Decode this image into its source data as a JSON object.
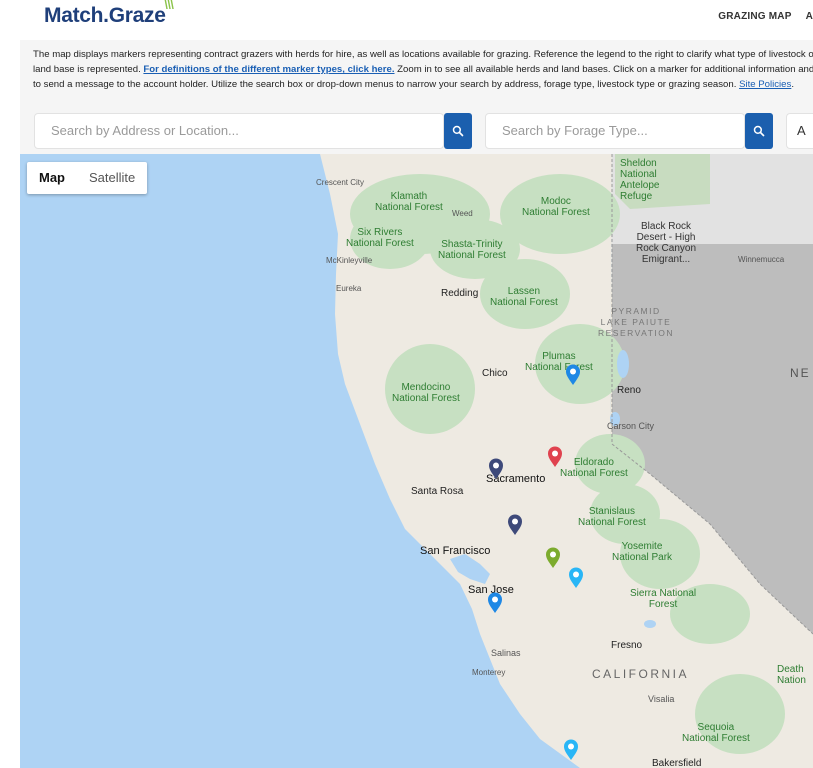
{
  "header": {
    "logo_text": "Match.Graze",
    "logo_accent": "\\\\\\",
    "nav": [
      "GRAZING MAP",
      "A"
    ]
  },
  "intro": {
    "text_before_link": "The map displays markers representing contract grazers with herds for hire, as well as locations available for grazing. Reference the legend to the right to clarify what type of livestock or land base is represented. ",
    "link_text": "For definitions of the different marker types, click here.",
    "text_after_link": " Zoom in to see all available herds and land bases. Click on a marker for additional information and to send a message to the account holder. Utilize the search box or drop-down menus to narrow your search by address, forage type, livestock type or grazing season. ",
    "policies_link": "Site Policies",
    "policies_suffix": "."
  },
  "search": {
    "address_placeholder": "Search by Address or Location...",
    "forage_placeholder": "Search by Forage Type...",
    "third_value": "A"
  },
  "map": {
    "map_type_options": [
      "Map",
      "Satellite"
    ],
    "selected_map_type": "Map",
    "labels": {
      "crescent_city": "Crescent City",
      "klamath": "Klamath\nNational Forest",
      "weed": "Weed",
      "modoc": "Modoc\nNational Forest",
      "sheldon": "Sheldon\nNational\nAntelope\nRefuge",
      "six_rivers": "Six Rivers\nNational Forest",
      "shasta": "Shasta-Trinity\nNational Forest",
      "mckinleyville": "McKinleyville",
      "black_rock": "Black Rock\nDesert - High\nRock Canyon\nEmigrant...",
      "winnemucca": "Winnemucca",
      "eureka": "Eureka",
      "redding": "Redding",
      "lassen": "Lassen\nNational Forest",
      "pyramid": "PYRAMID\nLAKE PAIUTE\nRESERVATION",
      "plumas": "Plumas\nNational Forest",
      "chico": "Chico",
      "reno": "Reno",
      "mendocino": "Mendocino\nNational Forest",
      "carson": "Carson City",
      "eldorado": "Eldorado\nNational Forest",
      "sacramento": "Sacramento",
      "santa_rosa": "Santa Rosa",
      "stanislaus": "Stanislaus\nNational Forest",
      "san_francisco": "San Francisco",
      "yosemite": "Yosemite\nNational Park",
      "san_jose": "San Jose",
      "sierra": "Sierra National\nForest",
      "salinas": "Salinas",
      "monterey": "Monterey",
      "fresno": "Fresno",
      "california": "CALIFORNIA",
      "visalia": "Visalia",
      "sequoia": "Sequoia\nNational Forest",
      "death_valley": "Death\nNation",
      "bakersfield": "Bakersfield",
      "nevada_partial": "NE"
    },
    "marker_colors": {
      "blue": "#1e88e5",
      "navy": "#3e4a7a",
      "red": "#e0424f",
      "olive": "#7cab2d",
      "cyan": "#29b6f6"
    }
  }
}
